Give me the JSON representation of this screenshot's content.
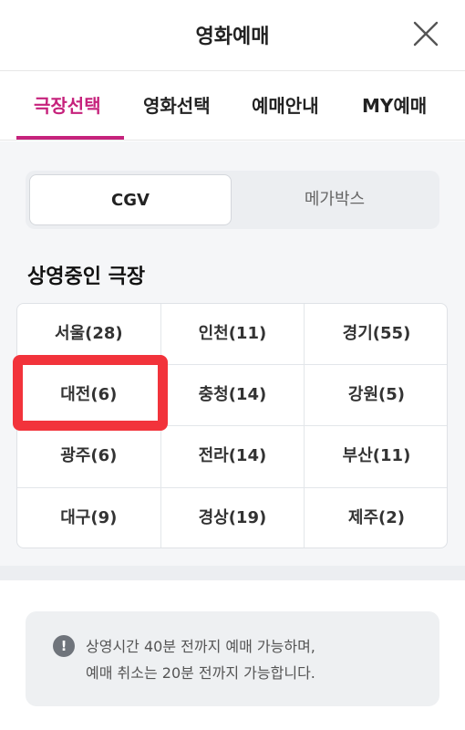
{
  "header": {
    "title": "영화예매",
    "close_icon": "close-icon"
  },
  "tabs": [
    {
      "label": "극장선택",
      "active": true
    },
    {
      "label": "영화선택",
      "active": false
    },
    {
      "label": "예매안내",
      "active": false
    },
    {
      "label": "MY예매",
      "active": false
    }
  ],
  "segment": [
    {
      "label": "CGV",
      "active": true
    },
    {
      "label": "메가박스",
      "active": false
    }
  ],
  "section_title": "상영중인 극장",
  "regions": [
    "서울(28)",
    "인천(11)",
    "경기(55)",
    "대전(6)",
    "충청(14)",
    "강원(5)",
    "광주(6)",
    "전라(14)",
    "부산(11)",
    "대구(9)",
    "경상(19)",
    "제주(2)"
  ],
  "notice": {
    "icon": "info-icon",
    "line1": "상영시간 40분 전까지 예매 가능하며,",
    "line2": "예매 취소는 20분 전까지 가능합니다."
  },
  "colors": {
    "accent": "#c6227c",
    "highlight": "#f2333b"
  }
}
